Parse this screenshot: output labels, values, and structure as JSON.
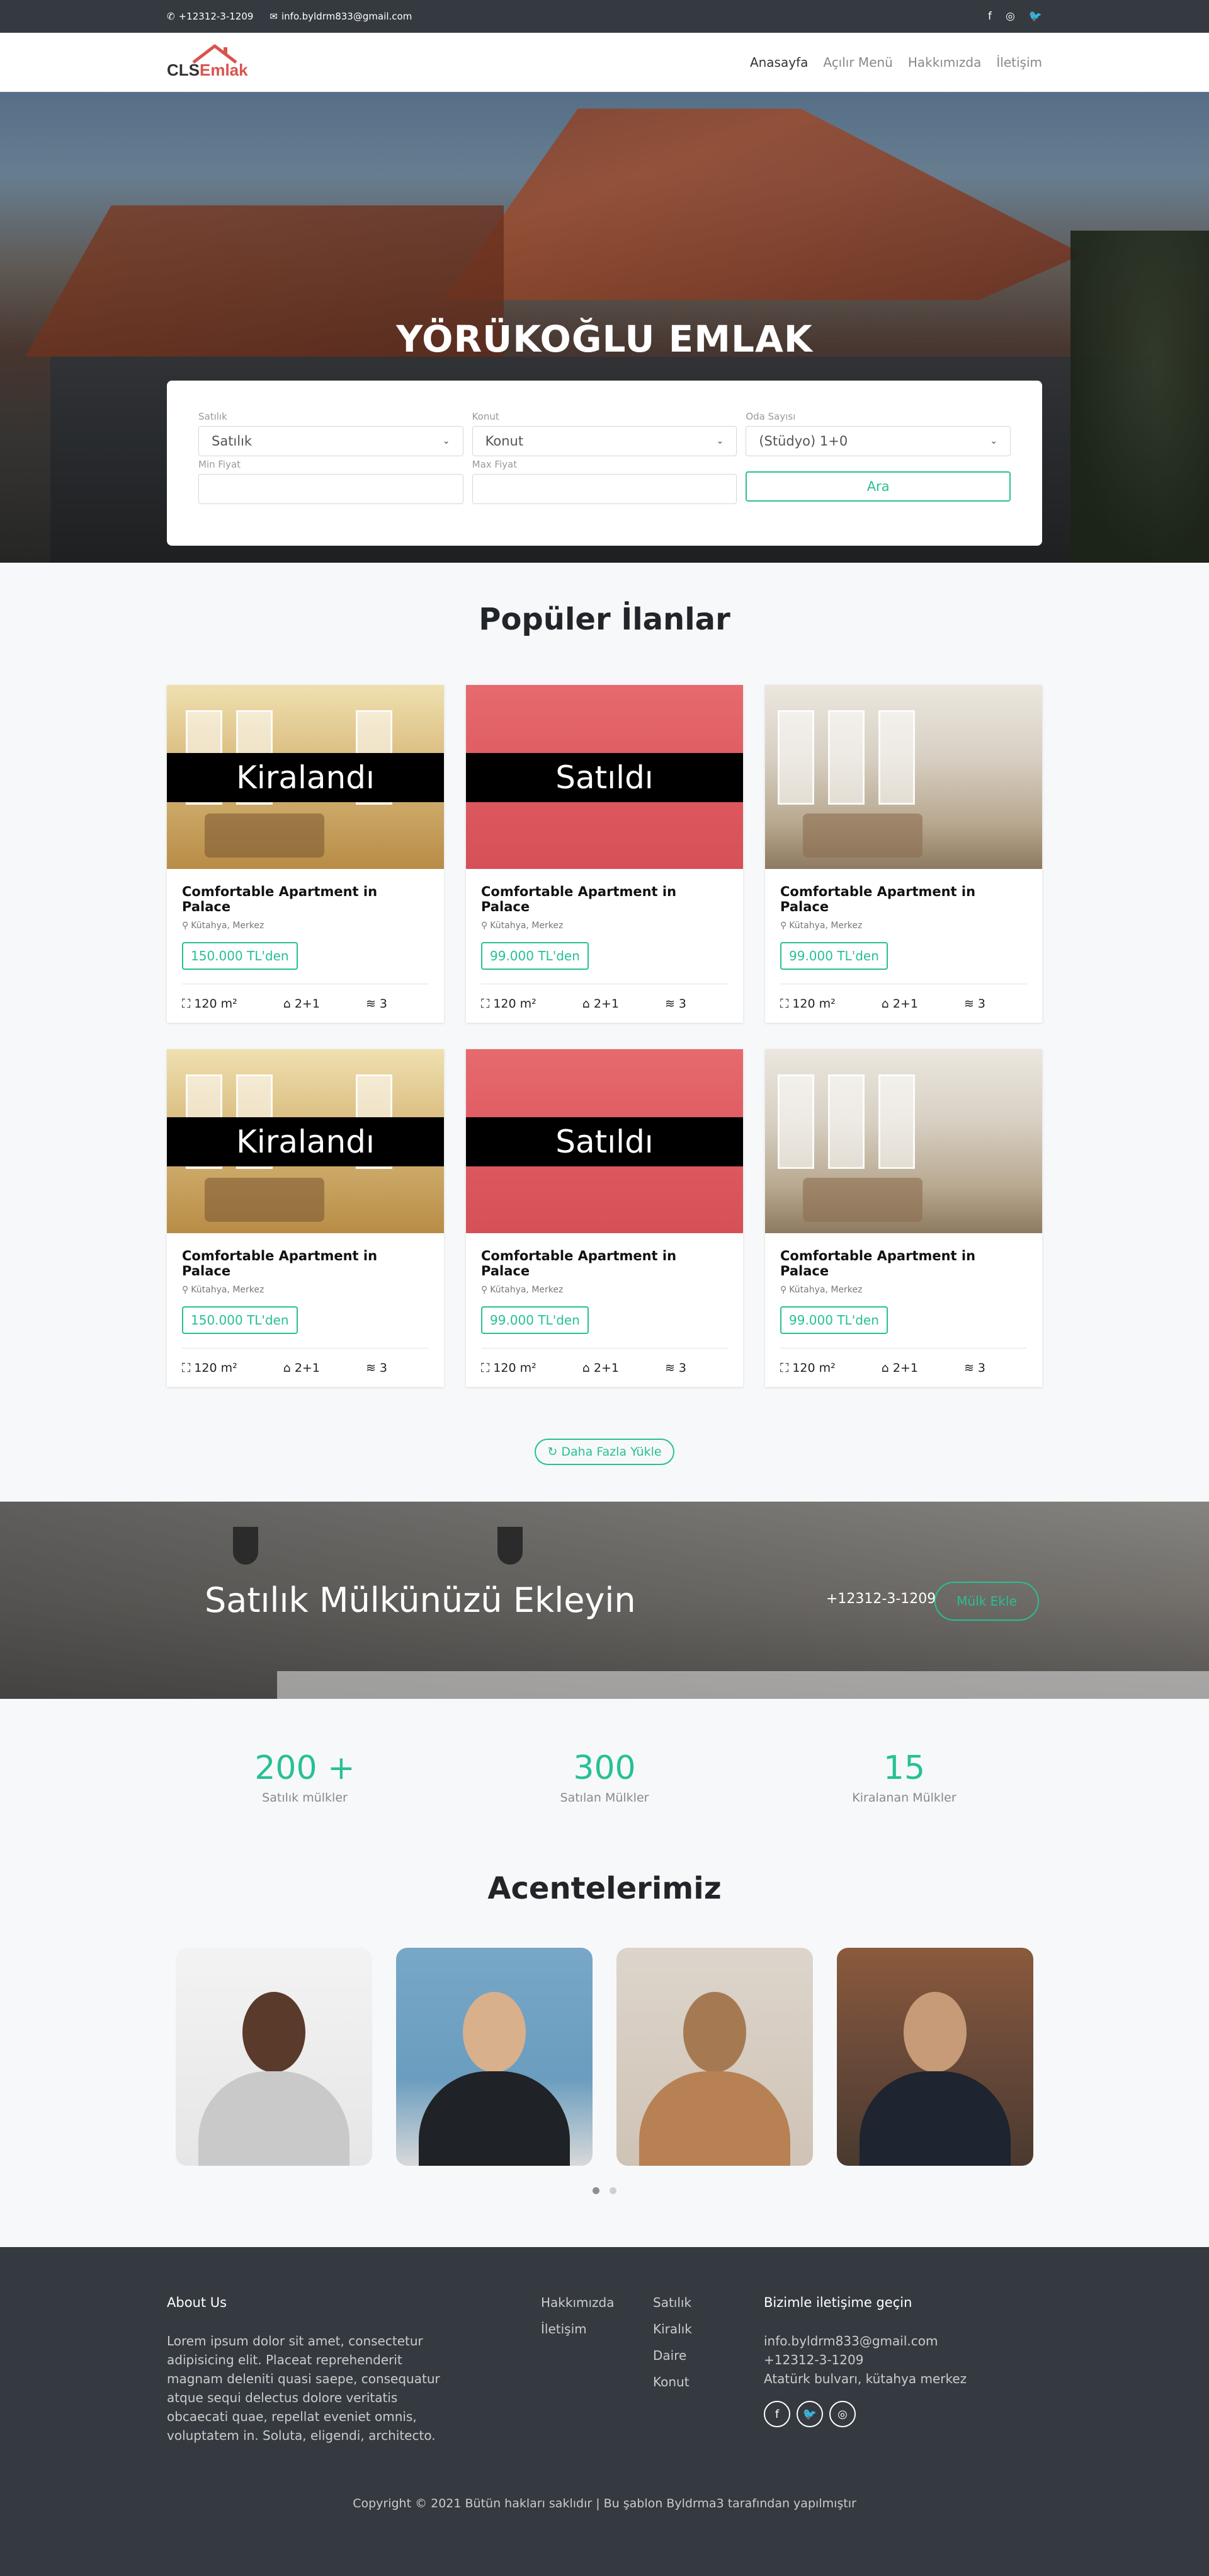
{
  "topbar": {
    "phone": "+12312-3-1209",
    "email": "info.byldrm833@gmail.com",
    "social": [
      "f",
      "◎",
      "🐦"
    ]
  },
  "brand": {
    "part1": "CLS",
    "part2": "Emlak"
  },
  "nav": {
    "items": [
      {
        "label": "Anasayfa"
      },
      {
        "label": "Açılır Menü"
      },
      {
        "label": "Hakkımızda"
      },
      {
        "label": "İletişim"
      }
    ]
  },
  "hero": {
    "title": "YÖRÜKOĞLU EMLAK",
    "search": {
      "status_label": "Satılık",
      "status_value": "Satılık",
      "type_label": "Konut",
      "type_value": "Konut",
      "rooms_label": "Oda Sayısı",
      "rooms_value": "(Stüdyo) 1+0",
      "min_label": "Min Fiyat",
      "max_label": "Max Fiyat",
      "button": "Ara"
    }
  },
  "popular": {
    "title": "Popüler İlanlar",
    "cards": [
      {
        "banner": "Kiralandı",
        "title": "Comfortable Apartment in Palace",
        "location": "Kütahya, Merkez",
        "price": "150.000 TL'den",
        "area": "120 m²",
        "rooms": "2+1",
        "floors": "3"
      },
      {
        "banner": "Satıldı",
        "title": "Comfortable Apartment in Palace",
        "location": "Kütahya, Merkez",
        "price": "99.000 TL'den",
        "area": "120 m²",
        "rooms": "2+1",
        "floors": "3"
      },
      {
        "banner": "",
        "title": "Comfortable Apartment in Palace",
        "location": "Kütahya, Merkez",
        "price": "99.000 TL'den",
        "area": "120 m²",
        "rooms": "2+1",
        "floors": "3"
      },
      {
        "banner": "Kiralandı",
        "title": "Comfortable Apartment in Palace",
        "location": "Kütahya, Merkez",
        "price": "150.000 TL'den",
        "area": "120 m²",
        "rooms": "2+1",
        "floors": "3"
      },
      {
        "banner": "Satıldı",
        "title": "Comfortable Apartment in Palace",
        "location": "Kütahya, Merkez",
        "price": "99.000 TL'den",
        "area": "120 m²",
        "rooms": "2+1",
        "floors": "3"
      },
      {
        "banner": "",
        "title": "Comfortable Apartment in Palace",
        "location": "Kütahya, Merkez",
        "price": "99.000 TL'den",
        "area": "120 m²",
        "rooms": "2+1",
        "floors": "3"
      }
    ],
    "more_button": "Daha Fazla Yükle"
  },
  "cta": {
    "text": "Satılık Mülkünüzü Ekleyin",
    "phone": "+12312-3-1209",
    "button": "Mülk Ekle"
  },
  "stats": [
    {
      "value": "200 +",
      "label": "Satılık mülkler"
    },
    {
      "value": "300",
      "label": "Satılan Mülkler"
    },
    {
      "value": "15",
      "label": "Kiralanan Mülkler"
    }
  ],
  "agents": {
    "title": "Acentelerimiz"
  },
  "footer": {
    "about_title": "About Us",
    "about_text": "Lorem ipsum dolor sit amet, consectetur adipisicing elit. Placeat reprehenderit magnam deleniti quasi saepe, consequatur atque sequi delectus dolore veritatis obcaecati quae, repellat eveniet omnis, voluptatem in. Soluta, eligendi, architecto.",
    "links1": [
      "Hakkımızda",
      "İletişim"
    ],
    "links2": [
      "Satılık",
      "Kiralık",
      "Daire",
      "Konut"
    ],
    "contact_title": "Bizimle iletişime geçin",
    "contact_email": "info.byldrm833@gmail.com",
    "contact_phone": "+12312-3-1209",
    "contact_address": "Atatürk bulvarı, kütahya merkez",
    "copyright": "Copyright © 2021 Bütün hakları saklıdır | Bu şablon Byldrma3 tarafından yapılmıştır"
  },
  "colors": {
    "accent": "#27c095",
    "dark": "#343a40",
    "brand_red": "#d9534f"
  }
}
